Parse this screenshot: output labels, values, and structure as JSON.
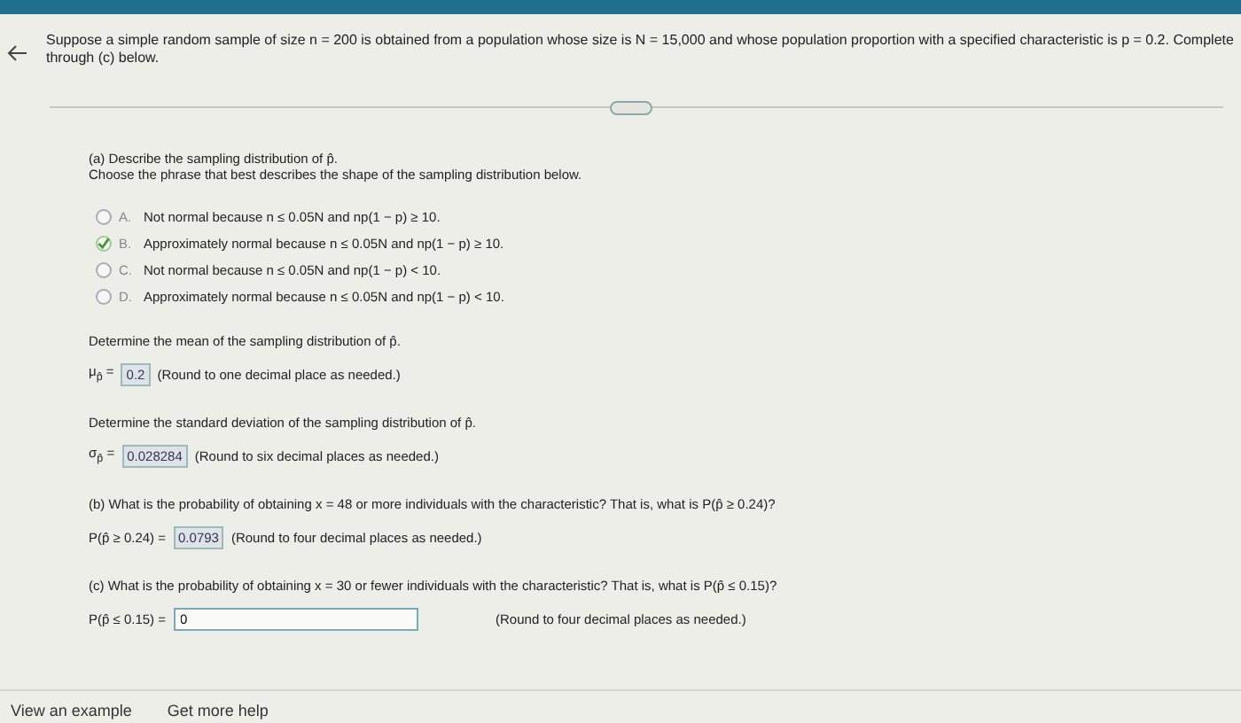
{
  "question": "Suppose a simple random sample of size n = 200 is obtained from a population whose size is N = 15,000 and whose population proportion with a specified characteristic is p = 0.2. Complete through (c) below.",
  "part_a": {
    "heading": "(a) Describe the sampling distribution of p̂.",
    "instruction": "Choose the phrase that best describes the shape of the sampling distribution below.",
    "options": [
      {
        "letter": "A.",
        "text": "Not normal because n ≤ 0.05N and np(1 − p) ≥ 10.",
        "selected": false
      },
      {
        "letter": "B.",
        "text": "Approximately normal because n ≤ 0.05N and np(1 − p) ≥ 10.",
        "selected": true
      },
      {
        "letter": "C.",
        "text": "Not normal because n ≤ 0.05N and np(1 − p) < 10.",
        "selected": false
      },
      {
        "letter": "D.",
        "text": "Approximately normal because n ≤ 0.05N and np(1 − p) < 10.",
        "selected": false
      }
    ]
  },
  "steps": [
    {
      "prompt": "Determine the mean of the sampling distribution of p̂.",
      "label": "μ$_{p̂}$ =",
      "answer": "0.2",
      "hint": "(Round to one decimal place as needed.)"
    },
    {
      "prompt": "Determine the standard deviation of the sampling distribution of p̂.",
      "label": "σ$_{p̂}$ =",
      "answer": "0.028284",
      "hint": "(Round to six decimal places as needed.)"
    },
    {
      "prompt": "(b) What is the probability of obtaining x = 48 or more individuals with the characteristic? That is, what is P(p̂ ≥ 0.24)?",
      "label": "P(p̂ ≥ 0.24) =",
      "answer": "0.0793",
      "hint": "(Round to four decimal places as needed.)"
    }
  ],
  "part_c": {
    "prompt": "(c) What is the probability of obtaining x = 30 or fewer individuals with the characteristic? That is, what is P(p̂ ≤ 0.15)?",
    "label": "P(p̂ ≤ 0.15) =",
    "value": "0",
    "hint": "(Round to four decimal places as needed.)"
  },
  "footer": {
    "links": [
      "View an example",
      "Get more help"
    ]
  }
}
